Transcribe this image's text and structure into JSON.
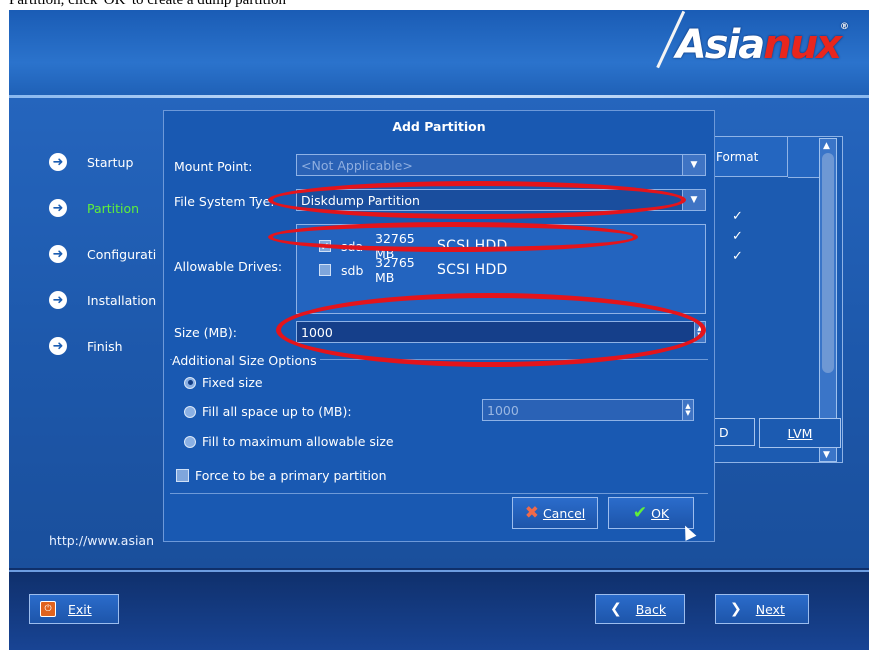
{
  "window": {
    "top_caption": "Partition, click 'OK' to create a dump partition",
    "logo_text": "Asianux",
    "logo_left": "Asia",
    "logo_right": "nux",
    "url": "http://www.asian"
  },
  "sidebar": {
    "items": [
      {
        "label": "Startup",
        "active": false
      },
      {
        "label": "Partition",
        "active": true
      },
      {
        "label": "Configurati",
        "active": false
      },
      {
        "label": "Installation",
        "active": false
      },
      {
        "label": "Finish",
        "active": false
      }
    ]
  },
  "background_panel": {
    "column_header": "Format",
    "checkmarks": [
      "✓",
      "✓",
      "✓"
    ],
    "d_button": "D",
    "lvm_button": "LVM"
  },
  "dialog": {
    "title": "Add Partition",
    "mount_point_label": "Mount Point:",
    "mount_point_value": "<Not Applicable>",
    "fs_type_label": "File System Ty",
    "fs_type_label_rest": "e:",
    "fs_type_value": "Diskdump Partition",
    "allowable_drives_label": "Allowable Drives:",
    "drives": [
      {
        "name": "sda",
        "size": "32765 MB",
        "type": "SCSI HDD",
        "checked": true
      },
      {
        "name": "sdb",
        "size": "32765 MB",
        "type": "SCSI HDD",
        "checked": false
      }
    ],
    "size_label": "Size (MB):",
    "size_value": "1000",
    "additional_options_label": "Additional Size Options",
    "options": [
      {
        "label": "Fixed size",
        "selected": true
      },
      {
        "label": "Fill all space up to (MB):",
        "selected": false
      },
      {
        "label": "Fill to maximum allowable size",
        "selected": false
      }
    ],
    "fill_up_to_value": "1000",
    "force_primary_label": "Force to be a primary partition",
    "cancel_label": "Cancel",
    "ok_label": "OK"
  },
  "footer": {
    "exit_label": "Exit",
    "back_label": "Back",
    "next_label": "Next"
  },
  "colors": {
    "background": "#1d4f9a",
    "accent_active": "#5fef3a",
    "annotation_red": "#e4141b"
  }
}
